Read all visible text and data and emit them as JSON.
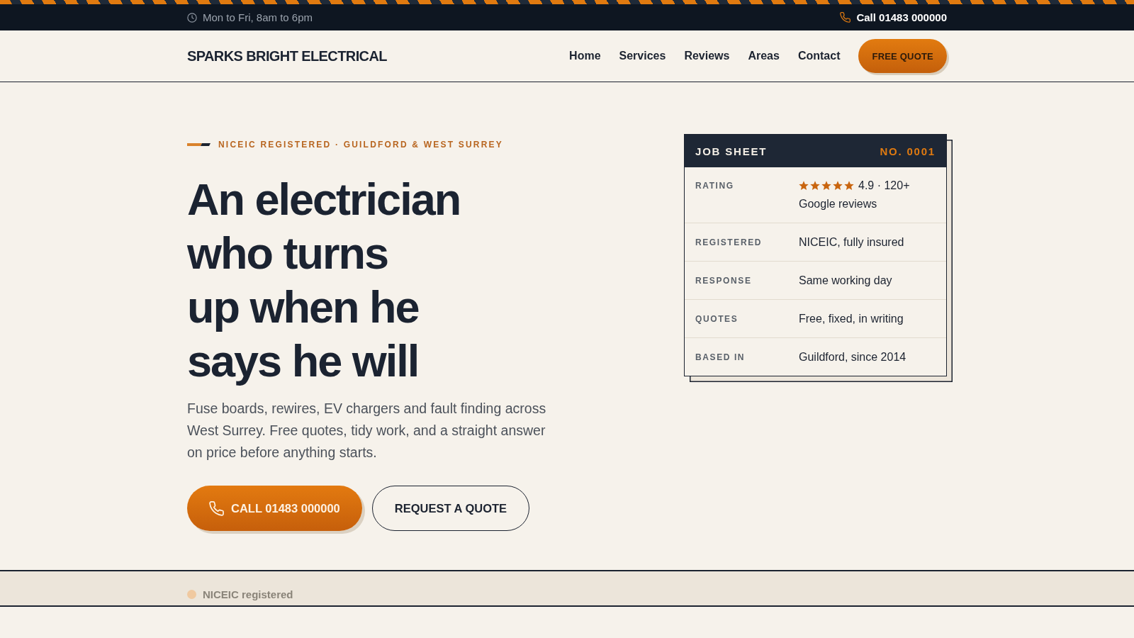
{
  "top_bar": {
    "hours": "Mon to Fri, 8am to 6pm",
    "phone_link": "Call 01483 000000"
  },
  "header": {
    "logo": "SPARKS BRIGHT ELECTRICAL",
    "nav": [
      "Home",
      "Services",
      "Reviews",
      "Areas",
      "Contact"
    ],
    "cta": "FREE QUOTE"
  },
  "hero": {
    "eyebrow": "NICEIC REGISTERED · GUILDFORD & WEST SURREY",
    "headline_lines": [
      "An electrician",
      "who turns",
      "up when he",
      "says he will"
    ],
    "intro": "Fuse boards, rewires, EV chargers and fault finding across West Surrey. Free quotes, tidy work, and a straight answer on price before anything starts.",
    "buttons": [
      {
        "label": "CALL 01483 000000",
        "kind": "primary"
      },
      {
        "label": "REQUEST A QUOTE",
        "kind": "outline"
      }
    ]
  },
  "job_sheet": {
    "title": "JOB SHEET",
    "number": "NO. 0001",
    "rows": [
      {
        "label": "RATING",
        "kind": "rating",
        "stars": 5,
        "value": "4.9 · 120+",
        "detail": "Google reviews"
      },
      {
        "label": "REGISTERED",
        "kind": "text",
        "value": "NICEIC, fully insured"
      },
      {
        "label": "RESPONSE",
        "kind": "text",
        "value": "Same working day"
      },
      {
        "label": "QUOTES",
        "kind": "text",
        "value": "Free, fixed, in writing"
      },
      {
        "label": "BASED IN",
        "kind": "text",
        "value": "Guildford, since 2014"
      }
    ]
  },
  "trust_strip": {
    "items": [
      "NICEIC registered"
    ]
  }
}
